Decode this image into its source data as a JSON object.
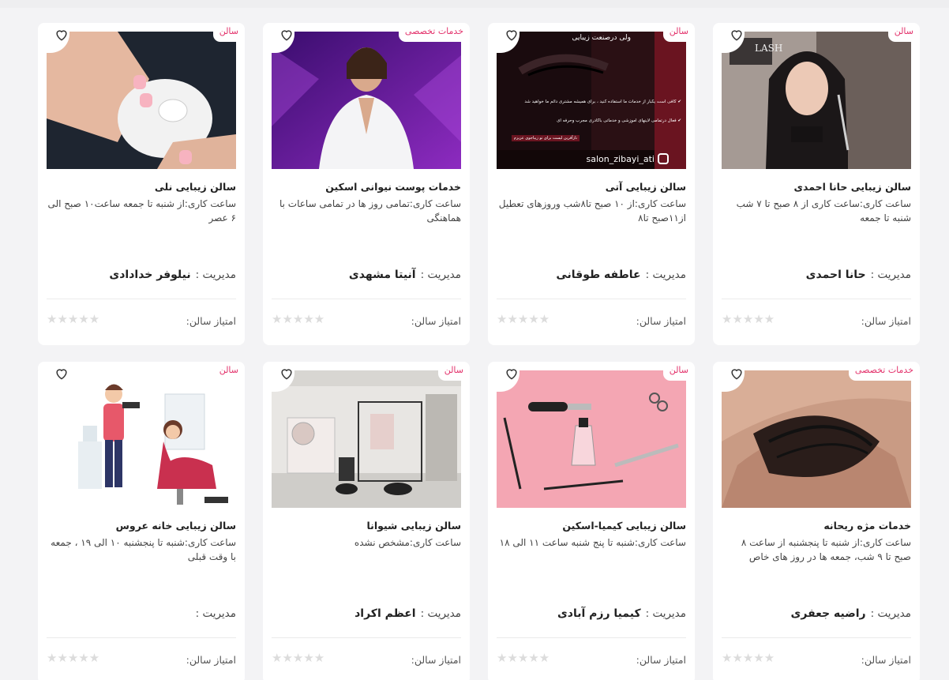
{
  "labels": {
    "hours_prefix": "ساعت کاری:",
    "manager_prefix": "مدیریت :",
    "rating_label": "امتیاز سالن:",
    "stars": "★★★★★"
  },
  "colors": {
    "badge": "#e3336c",
    "star_empty": "#dcdcdc"
  },
  "cards": [
    {
      "badge": "سالن",
      "title": "سالن زیبایی حانا احمدی",
      "hours": "ساعت کاری:ساعت کاری از ۸ صبح تا ۷ شب شنبه تا جمعه",
      "manager": "حانا احمدی",
      "image": "woman-portrait",
      "logo_text": "LASH"
    },
    {
      "badge": "سالن",
      "title": "سالن زیبایی آتی",
      "hours": "ساعت کاری:از ۱۰ صبح تا۸شب وروزهای تعطیل از۱۱صبح تا۸",
      "manager": "عاطفه طوقانی",
      "image": "eye-promo",
      "promo_lines": [
        "ولی درصنعت زیبایی",
        "✔ کافی است یکبار از خدمات ما استفاده کنید ، برای همیشه مشتری دائم ما خواهید شد",
        "✔ فعال درتمامی لاینهای آموزشی و خدماتی باکادری مجرب وحرفه ای",
        "نازآفرین لیست برای تو زیباجوی عزیزم"
      ],
      "instagram": "salon_zibayi_ati"
    },
    {
      "badge": "خدمات تخصصی",
      "title": "خدمات پوست نیوانی اسکین",
      "hours": "ساعت کاری:تمامی روز ها در تمامی ساعات با هماهنگی",
      "manager": "آنیتا مشهدی",
      "image": "doctor-purple"
    },
    {
      "badge": "سالن",
      "title": "سالن زیبایی نلی",
      "hours": "ساعت کاری:از شنبه تا جمعه ساعت۱۰ صبح الی ۶ عصر",
      "manager": "نیلوفر خدادادی",
      "image": "nails"
    },
    {
      "badge": "خدمات تخصصی",
      "title": "خدمات مژه ریحانه",
      "hours": "ساعت کاری:از شنبه تا پنجشنبه از ساعت ۸ صبح تا ۹ شب، جمعه ها در روز های خاص",
      "manager": "راضیه جعفری",
      "image": "eyelashes"
    },
    {
      "badge": "سالن",
      "title": "سالن زیبایی کیمیا-اسکین",
      "hours": "ساعت کاری:شنبه تا پنج شنبه ساعت ۱۱ الی ۱۸",
      "manager": "کیمیا رزم آبادی",
      "image": "tools-pink"
    },
    {
      "badge": "سالن",
      "title": "سالن زیبایی شیوانا",
      "hours": "ساعت کاری:مشخص نشده",
      "manager": "اعظم اکراد",
      "image": "salon-interior"
    },
    {
      "badge": "سالن",
      "title": "سالن زیبایی خانه عروس",
      "hours": "ساعت کاری:شنبه تا پنجشنبه ۱۰ الی ۱۹ ، جمعه با وقت قبلی",
      "manager": "",
      "image": "hairdresser-illustration"
    }
  ]
}
